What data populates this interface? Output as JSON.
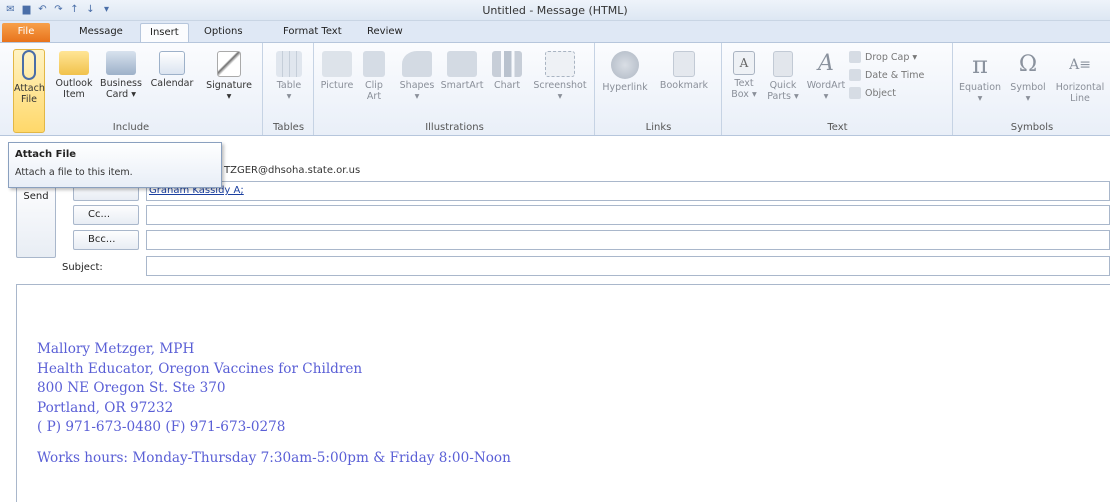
{
  "window": {
    "title": "Untitled - Message (HTML)"
  },
  "tabs": {
    "file": "File",
    "message": "Message",
    "insert": "Insert",
    "options": "Options",
    "format_text": "Format Text",
    "review": "Review"
  },
  "ribbon": {
    "include": {
      "label": "Include",
      "attach_file": "Attach",
      "attach_file2": "File",
      "outlook_item": "Outlook",
      "outlook_item2": "Item",
      "business_card": "Business",
      "business_card2": "Card ▾",
      "calendar": "Calendar",
      "signature": "Signature",
      "signature2": "▾"
    },
    "tables": {
      "label": "Tables",
      "table": "Table",
      "table2": "▾"
    },
    "illustrations": {
      "label": "Illustrations",
      "picture": "Picture",
      "clip_art": "Clip",
      "clip_art2": "Art",
      "shapes": "Shapes",
      "shapes2": "▾",
      "smartart": "SmartArt",
      "chart": "Chart",
      "screenshot": "Screenshot",
      "screenshot2": "▾"
    },
    "links": {
      "label": "Links",
      "hyperlink": "Hyperlink",
      "bookmark": "Bookmark"
    },
    "text": {
      "label": "Text",
      "text_box": "Text",
      "text_box2": "Box ▾",
      "quick_parts": "Quick",
      "quick_parts2": "Parts ▾",
      "wordart": "WordArt",
      "wordart2": "▾",
      "drop_cap": "Drop Cap ▾",
      "date_time": "Date & Time",
      "object": "Object"
    },
    "symbols": {
      "label": "Symbols",
      "equation": "Equation",
      "equation2": "▾",
      "symbol": "Symbol",
      "symbol2": "▾",
      "horizontal_line": "Horizontal",
      "horizontal_line2": "Line"
    }
  },
  "tooltip": {
    "title": "Attach File",
    "description": "Attach a file to this item."
  },
  "compose": {
    "from_partial": "TZGER@dhsoha.state.or.us",
    "send": "Send",
    "to_value": "Graham Kassidy A;",
    "cc_label": "Cc...",
    "bcc_label": "Bcc...",
    "subject_label": "Subject:"
  },
  "signature": {
    "line1": "Mallory Metzger, MPH",
    "line2": "Health Educator, Oregon Vaccines for Children",
    "line3": "800 NE Oregon St. Ste 370",
    "line4": "Portland, OR 97232",
    "line5": "( P) 971-673-0480 (F) 971-673-0278",
    "line6": "Works hours: Monday-Thursday 7:30am-5:00pm & Friday 8:00-Noon"
  },
  "colors": {
    "accent": "#e8731c",
    "signature_text": "#5a5fd6",
    "ribbon_bg": "#e9eff8"
  }
}
